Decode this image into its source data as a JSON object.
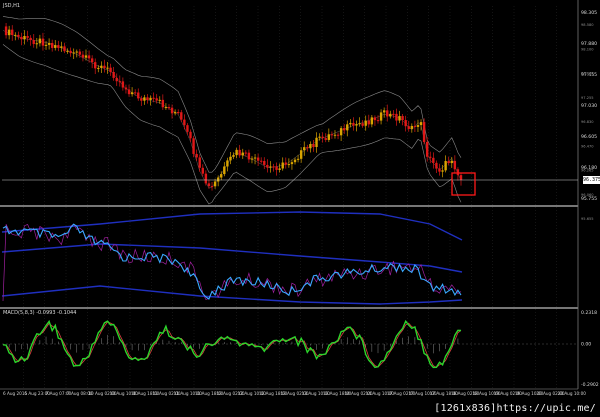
{
  "chart": {
    "symbol_label": "JSD,H1",
    "macd_label": "MACD(5,8,3) -0.0993 -0.1044",
    "current_price_tag": "96.375",
    "colors": {
      "background": "#000000",
      "bull_candle": "#d9a400",
      "bear_candle": "#e01818",
      "bollinger": "#8a8a8a",
      "close_line": "#cfcfcf",
      "highlight_box": "#ff1a1a",
      "stoch_main": "#39a9ff",
      "stoch_band": "#1f2fbf",
      "stoch_signal": "#a020a0",
      "macd_main": "#2bd62b",
      "macd_signal": "#d94040",
      "grid": "#2a2a2a",
      "separator": "#bdbdbd"
    },
    "price_axis": [
      "98.305",
      "97.880",
      "97.455",
      "97.030",
      "96.605",
      "96.180",
      "95.755"
    ],
    "price_axis_extra": [
      "98.580",
      "98.100",
      "97.675",
      "97.255",
      "96.830",
      "96.470",
      "96.265",
      "96.060",
      "95.655"
    ],
    "macd_axis": [
      "0.2318",
      "0.00",
      "-0.2902"
    ],
    "time_axis": [
      "6 Aug 2015",
      "6 Aug 23:00",
      "7 Aug 07:00",
      "7 Aug 08:00",
      "10 Aug 02:00",
      "10 Aug 10:00",
      "10 Aug 18:00",
      "11 Aug 02:00",
      "11 Aug 10:00",
      "11 Aug 18:00",
      "12 Aug 02:00",
      "12 Aug 10:00",
      "12 Aug 18:00",
      "13 Aug 02:00",
      "13 Aug 10:00",
      "13 Aug 18:00",
      "14 Aug 02:00",
      "14 Aug 10:00",
      "17 Aug 02:00",
      "17 Aug 10:00",
      "17 Aug 18:00",
      "18 Aug 02:00",
      "18 Aug 10:00",
      "19 Aug 02:00",
      "19 Aug 10:00",
      "20 Aug 02:00",
      "20 Aug 10:00"
    ]
  },
  "watermark": "[1261x836]https://upic.me/"
}
